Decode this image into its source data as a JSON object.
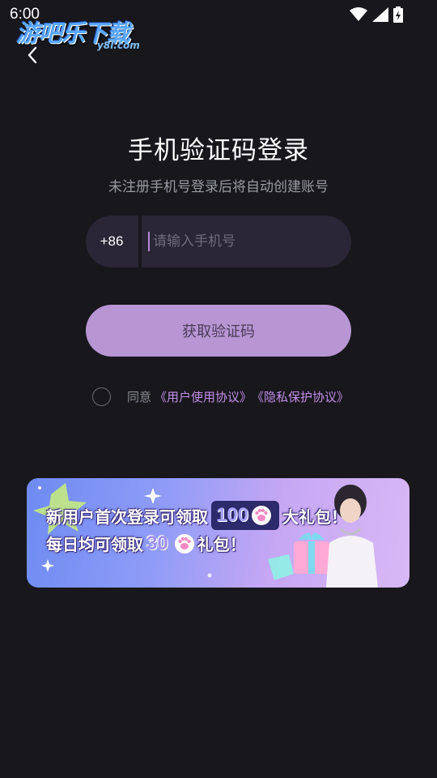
{
  "status_bar": {
    "time": "6:00",
    "icons": [
      "wifi-icon",
      "signal-icon",
      "battery-icon"
    ]
  },
  "watermark": {
    "title": "游吧乐下载",
    "subtitle": "y8l.com"
  },
  "login": {
    "title": "手机验证码登录",
    "subtitle": "未注册手机号登录后将自动创建账号",
    "country_code": "+86",
    "phone_placeholder": "请输入手机号",
    "phone_value": "",
    "get_code_label": "获取验证码",
    "agree_text": "同意",
    "user_agreement": "《用户使用协议》",
    "privacy_policy": "《隐私保护协议》",
    "agree_checked": false
  },
  "promo": {
    "line1_prefix": "新用户首次登录可领取",
    "line1_number": "100",
    "line1_suffix": "大礼包！",
    "line2_prefix": "每日均可领取",
    "line2_number": "30",
    "line2_suffix": "礼包！"
  },
  "colors": {
    "background": "#17171c",
    "input_bg": "#2a2636",
    "button_bg": "#b896d4",
    "link": "#c38ee8"
  }
}
